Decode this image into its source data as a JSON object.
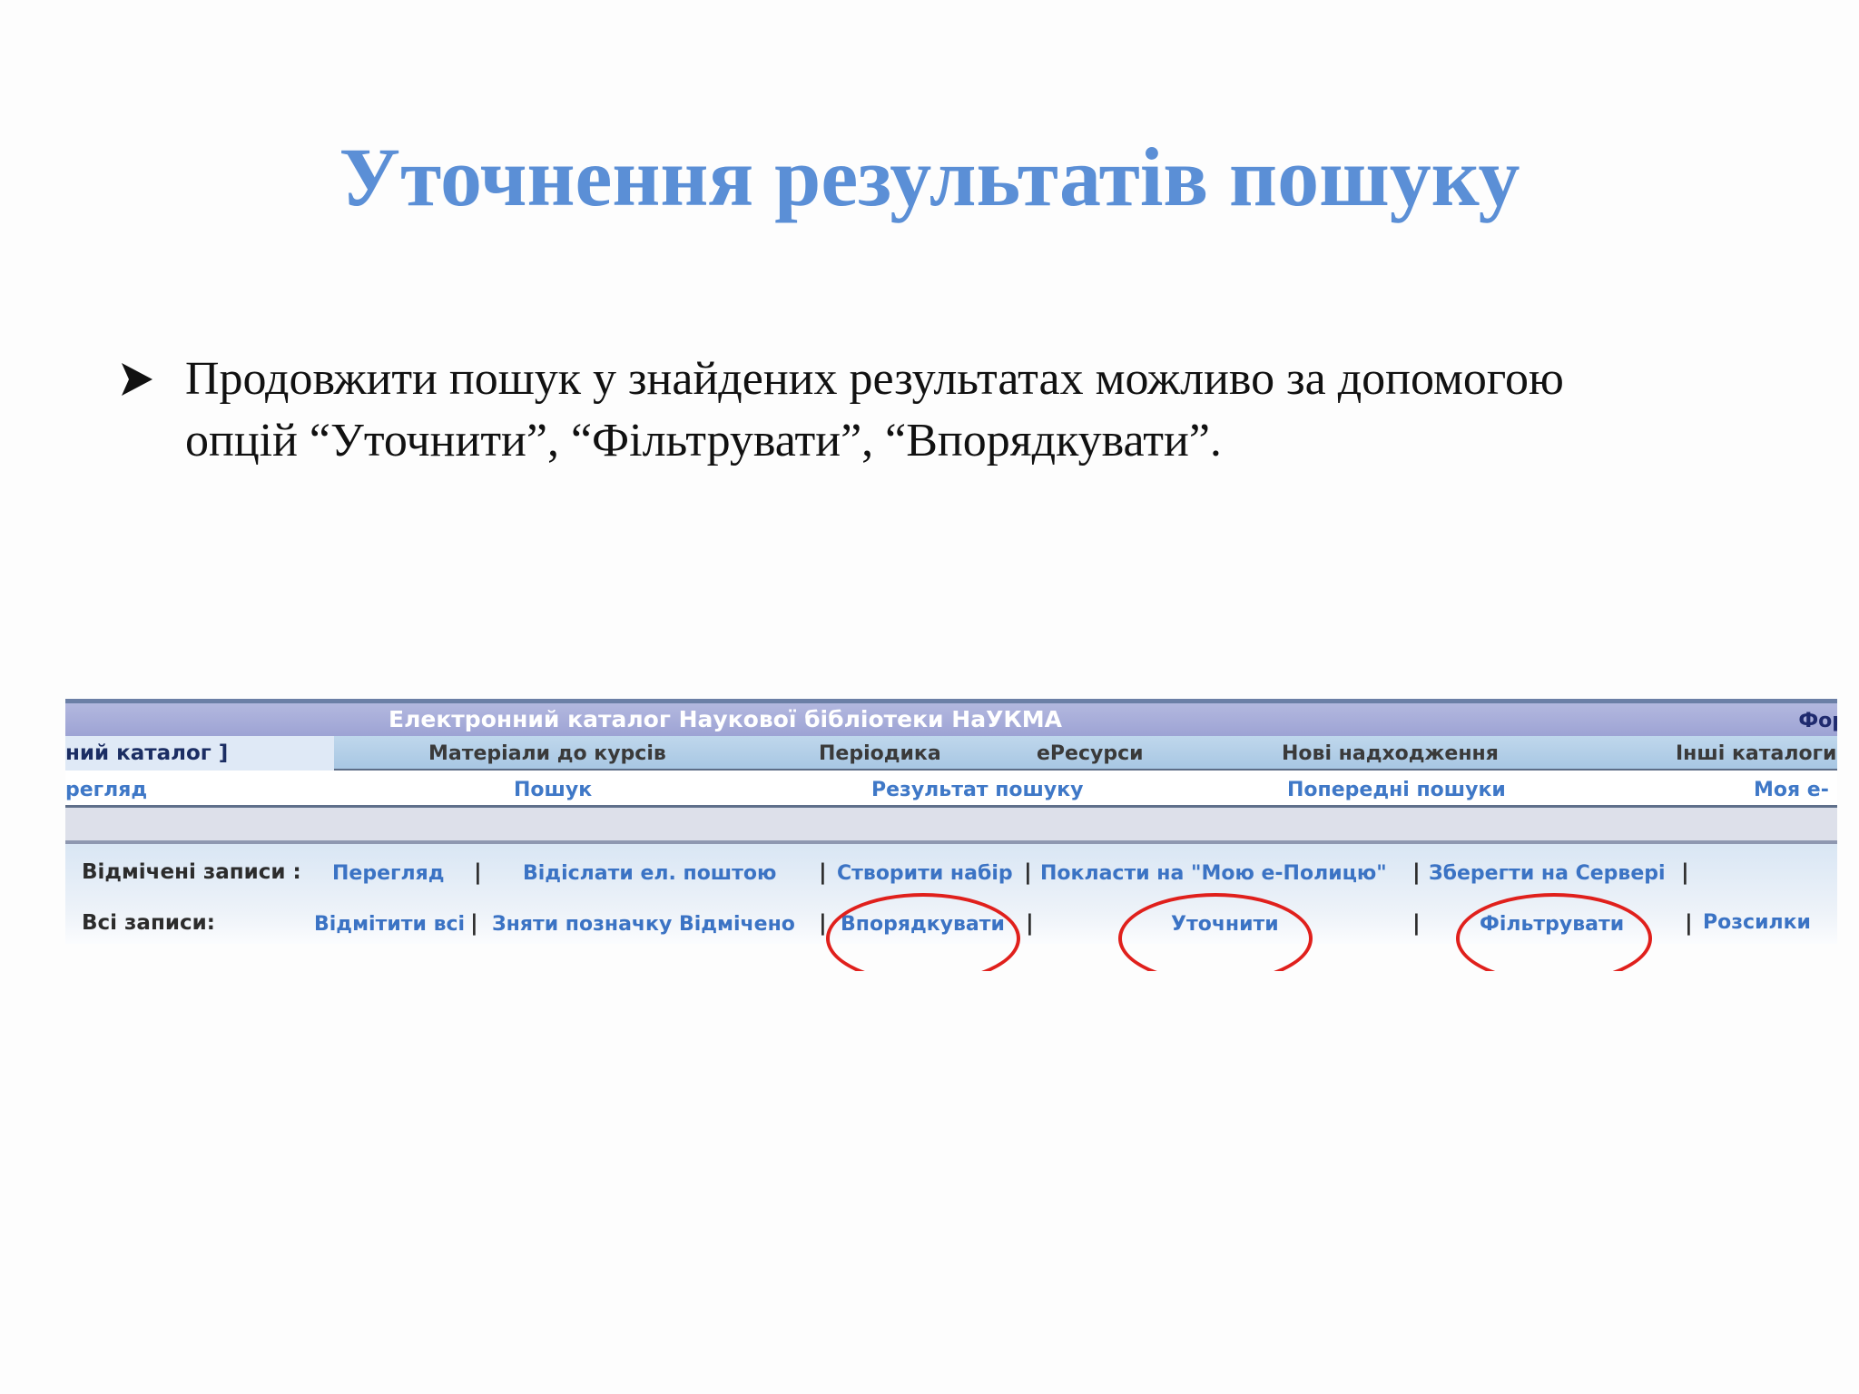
{
  "slide": {
    "title": "Уточнення результатів пошуку",
    "bullet_icon": "arrowhead-bullet-icon",
    "bullet_line1": "Продовжити пошук у знайдених результатах можливо за допомогою",
    "bullet_line2": "опцій “Уточнити”, “Фільтрувати”, “Впорядкувати”."
  },
  "catalog": {
    "header_title": "Електронний каталог Наукової бібліотеки НаУКМА",
    "header_right": "Фор",
    "tabs": {
      "current": "ний каталог ]",
      "courses": "Матеріали до курсів",
      "periodicals": "Періодика",
      "eresources": "еРесурси",
      "new_arrivals": "Нові надходження",
      "other_catalogs": "Інші каталоги"
    },
    "subnav": {
      "view": "регляд",
      "search": "Пошук",
      "results": "Результат пошуку",
      "previous": "Попередні пошуки",
      "my": "Моя е-"
    },
    "marked": {
      "label": "Відмічені записи :",
      "view": "Перегляд",
      "email": "Відіслати ел. поштою",
      "create_set": "Створити набір",
      "shelf": "Покласти на \"Мою е-Полицю\"",
      "save_server": "Зберегти на Сервері"
    },
    "all": {
      "label": "Всі записи:",
      "mark_all": "Відмітити всі",
      "unmark": "Зняти позначку Відмічено",
      "sort": "Впорядкувати",
      "refine": "Уточнити",
      "filter": "Фільтрувати",
      "mailing": "Розсилки"
    },
    "separator": "|",
    "highlight_color": "#e0201c"
  }
}
